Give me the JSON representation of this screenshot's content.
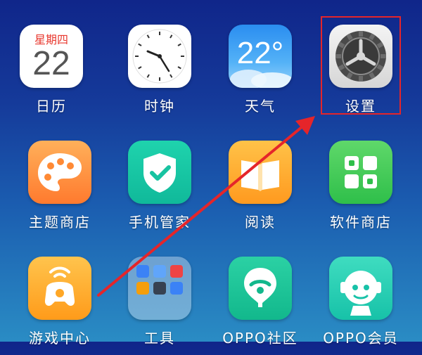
{
  "apps": [
    {
      "id": "calendar",
      "label": "日历",
      "weekday": "星期四",
      "day": "22"
    },
    {
      "id": "clock",
      "label": "时钟"
    },
    {
      "id": "weather",
      "label": "天气",
      "temperature": "22°"
    },
    {
      "id": "settings",
      "label": "设置"
    },
    {
      "id": "theme-store",
      "label": "主题商店"
    },
    {
      "id": "phone-manager",
      "label": "手机管家"
    },
    {
      "id": "reader",
      "label": "阅读"
    },
    {
      "id": "software-store",
      "label": "软件商店"
    },
    {
      "id": "game-center",
      "label": "游戏中心"
    },
    {
      "id": "tools",
      "label": "工具"
    },
    {
      "id": "oppo-community",
      "label": "OPPO社区"
    },
    {
      "id": "oppo-member",
      "label": "OPPO会员"
    }
  ],
  "colors": {
    "annotation": "#e5252a",
    "background_top": "#10268a",
    "background_bottom": "#2a8cc4"
  },
  "icons": {
    "calendar": "calendar-icon",
    "clock": "clock-icon",
    "weather": "weather-icon",
    "settings": "gear-icon",
    "theme-store": "palette-icon",
    "phone-manager": "shield-check-icon",
    "reader": "book-icon",
    "software-store": "app-grid-icon",
    "game-center": "gamepad-icon",
    "tools": "folder-icon",
    "oppo-community": "balloon-icon",
    "oppo-member": "robot-face-icon"
  }
}
